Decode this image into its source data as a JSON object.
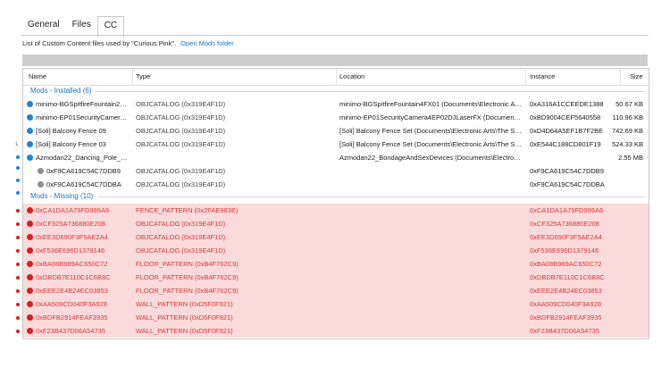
{
  "tabs": [
    "General",
    "Files",
    "CC"
  ],
  "description": "List of Custom Content files used by \"Curious Pink\".",
  "open_mods_folder_label": "Open Mods folder",
  "columns": {
    "name": "Name",
    "type": "Type",
    "location": "Location",
    "instance": "Instance",
    "size": "Size"
  },
  "installed_group_label": "Mods - Installed  (6)",
  "missing_group_label": "Mods - Missing  (10)",
  "installed": [
    {
      "name": "minimo-BGSpitfireFountain2SP0...",
      "type": "OBJCATALOG (0x319E4F1D)",
      "location": "minimo-BGSpitfireFountain4FX01 (Documents\\Electronic Arts\\Th...",
      "instance": "0xA316A1CCEEDE1388",
      "size": "50.67 KB",
      "child": false
    },
    {
      "name": "minimo-EP01SecurityCamera4E...",
      "type": "OBJCATALOG (0x319E4F1D)",
      "location": "minimo-EP01SecurityCamera4EP02DJLaserFX (Documents\\Elec...",
      "instance": "0xBD9004CEF5640558",
      "size": "110.96 KB",
      "child": false
    },
    {
      "name": "[Soli] Balcony Fence 09",
      "type": "OBJCATALOG (0x319E4F1D)",
      "location": "[Soli] Balcony Fence Set (Documents\\Electronic Arts\\The Sims ...",
      "instance": "0xD4D64A5EF1B7F2BE",
      "size": "742.69 KB",
      "child": false
    },
    {
      "name": "[Soli] Balcony Fence 03",
      "type": "OBJCATALOG (0x319E4F1D)",
      "location": "[Soli] Balcony Fence Set (Documents\\Electronic Arts\\The Sims ...",
      "instance": "0xE544C188CD801F19",
      "size": "524.33 KB",
      "child": false
    },
    {
      "name": "Azmodan22_Dancing_Pole_Tall",
      "type": "",
      "location": "Azmodan22_BondageAndSexDevices (Documents\\Electronic A...",
      "instance": "",
      "size": "2.55 MB",
      "child": false
    },
    {
      "name": "0xF9CA619C54C7DDB9",
      "type": "OBJCATALOG (0x319E4F1D)",
      "location": "",
      "instance": "0xF9CA619C54C7DDB9",
      "size": "",
      "child": true
    },
    {
      "name": "0xF9CA619C54C7DDBA",
      "type": "OBJCATALOG (0x319E4F1D)",
      "location": "",
      "instance": "0xF9CA619C54C7DDBA",
      "size": "",
      "child": true
    }
  ],
  "missing": [
    {
      "name": "0xCA1DA1A79FD999A6",
      "type": "FENCE_PATTERN (0x2FAE983E)",
      "instance": "0xCA1DA1A79FD999A6"
    },
    {
      "name": "0xCF325A736880E208",
      "type": "OBJCATALOG (0x319E4F1D)",
      "instance": "0xCF325A736880E208"
    },
    {
      "name": "0xEE3D690F3F5AE2A4",
      "type": "OBJCATALOG (0x319E4F1D)",
      "instance": "0xEE3D690F3F5AE2A4"
    },
    {
      "name": "0xF536E696D1379146",
      "type": "OBJCATALOG (0x319E4F1D)",
      "instance": "0xF536E696D1379146"
    },
    {
      "name": "0xBA08B989AC650C72",
      "type": "FLOOR_PATTERN (0xB4F762C9)",
      "instance": "0xBA08B989AC650C72"
    },
    {
      "name": "0xDBDB7E110C1C6B8C",
      "type": "FLOOR_PATTERN (0xB4F762C9)",
      "instance": "0xDBDB7E110C1C6B8C"
    },
    {
      "name": "0xEEE2E4B24EC03853",
      "type": "FLOOR_PATTERN (0xB4F762C9)",
      "instance": "0xEEE2E4B24EC03853"
    },
    {
      "name": "0xAA509CD040F3A928",
      "type": "WALL_PATTERN (0xD5F0F921)",
      "instance": "0xAA509CD040F3A928"
    },
    {
      "name": "0xBDFB2914FEAF3935",
      "type": "WALL_PATTERN (0xD5F0F921)",
      "instance": "0xBDFB2914FEAF3935"
    },
    {
      "name": "0xF23B437D06A54735",
      "type": "WALL_PATTERN (0xD5F0F921)",
      "instance": "0xF23B437D06A54735"
    }
  ],
  "colors": {
    "accent": "#1a73c8",
    "installed_dot": "#1e84d6",
    "child_dot": "#8f8f8f",
    "missing_dot": "#e01b1b",
    "missing_row_bg": "#fadada",
    "missing_text": "#d43a3a"
  },
  "icons": {
    "installed": "status-ok-icon",
    "child": "sub-item-icon",
    "missing": "status-missing-icon"
  }
}
